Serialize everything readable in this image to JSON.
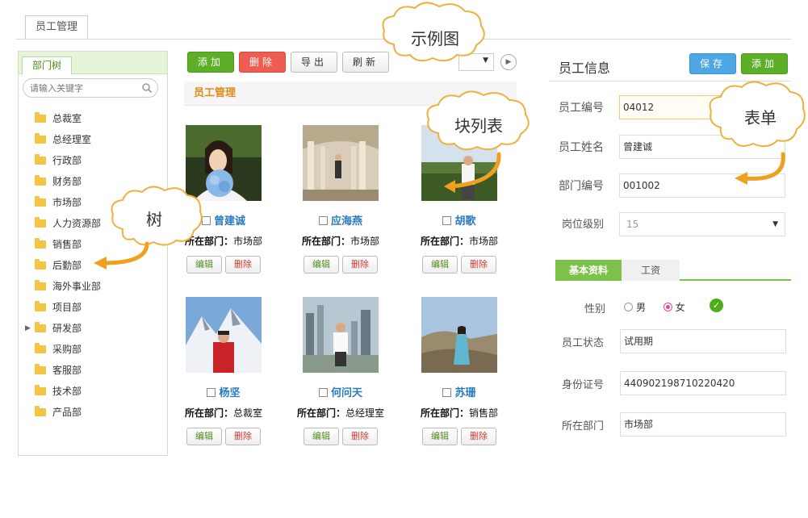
{
  "top_tab": {
    "label": "员工管理"
  },
  "tree": {
    "tab_label": "部门树",
    "search_placeholder": "请输入关键字",
    "items": [
      "总裁室",
      "总经理室",
      "行政部",
      "财务部",
      "市场部",
      "人力资源部",
      "销售部",
      "后勤部",
      "海外事业部",
      "项目部",
      "研发部",
      "采购部",
      "客服部",
      "技术部",
      "产品部"
    ]
  },
  "toolbar": {
    "add": "添加",
    "delete": "删除",
    "export": "导出",
    "refresh": "刷新"
  },
  "list": {
    "section_title": "员工管理",
    "dept_label": "所在部门：",
    "edit_label": "编辑",
    "delete_label": "删除",
    "employees": [
      {
        "name": "曾建诚",
        "dept": "市场部"
      },
      {
        "name": "应海燕",
        "dept": "市场部"
      },
      {
        "name": "胡歌",
        "dept": "市场部"
      },
      {
        "name": "杨坚",
        "dept": "总裁室"
      },
      {
        "name": "何问天",
        "dept": "总经理室"
      },
      {
        "name": "苏珊",
        "dept": "销售部"
      }
    ]
  },
  "form": {
    "title": "员工信息",
    "save": "保存",
    "add": "添加",
    "fields": {
      "emp_no": {
        "label": "员工编号",
        "value": "04012"
      },
      "emp_name": {
        "label": "员工姓名",
        "value": "曾建诚"
      },
      "dept_no": {
        "label": "部门编号",
        "value": "001002"
      },
      "post_level": {
        "label": "岗位级别",
        "value": "15"
      }
    },
    "tabs": {
      "basic": "基本资料",
      "salary": "工资"
    },
    "gender": {
      "label": "性别",
      "male": "男",
      "female": "女",
      "selected": "女"
    },
    "status": {
      "label": "员工状态",
      "value": "试用期"
    },
    "id_card": {
      "label": "身份证号",
      "value": "440902198710220420"
    },
    "dept": {
      "label": "所在部门",
      "value": "市场部"
    }
  },
  "callouts": {
    "example": "示例图",
    "tree": "树",
    "block_list": "块列表",
    "form": "表单"
  },
  "colors": {
    "green": "#5daf2a",
    "red": "#ee5d52",
    "blue": "#4ea6e4",
    "orange_title": "#e08a1a",
    "callout_arrow": "#f0a020"
  }
}
